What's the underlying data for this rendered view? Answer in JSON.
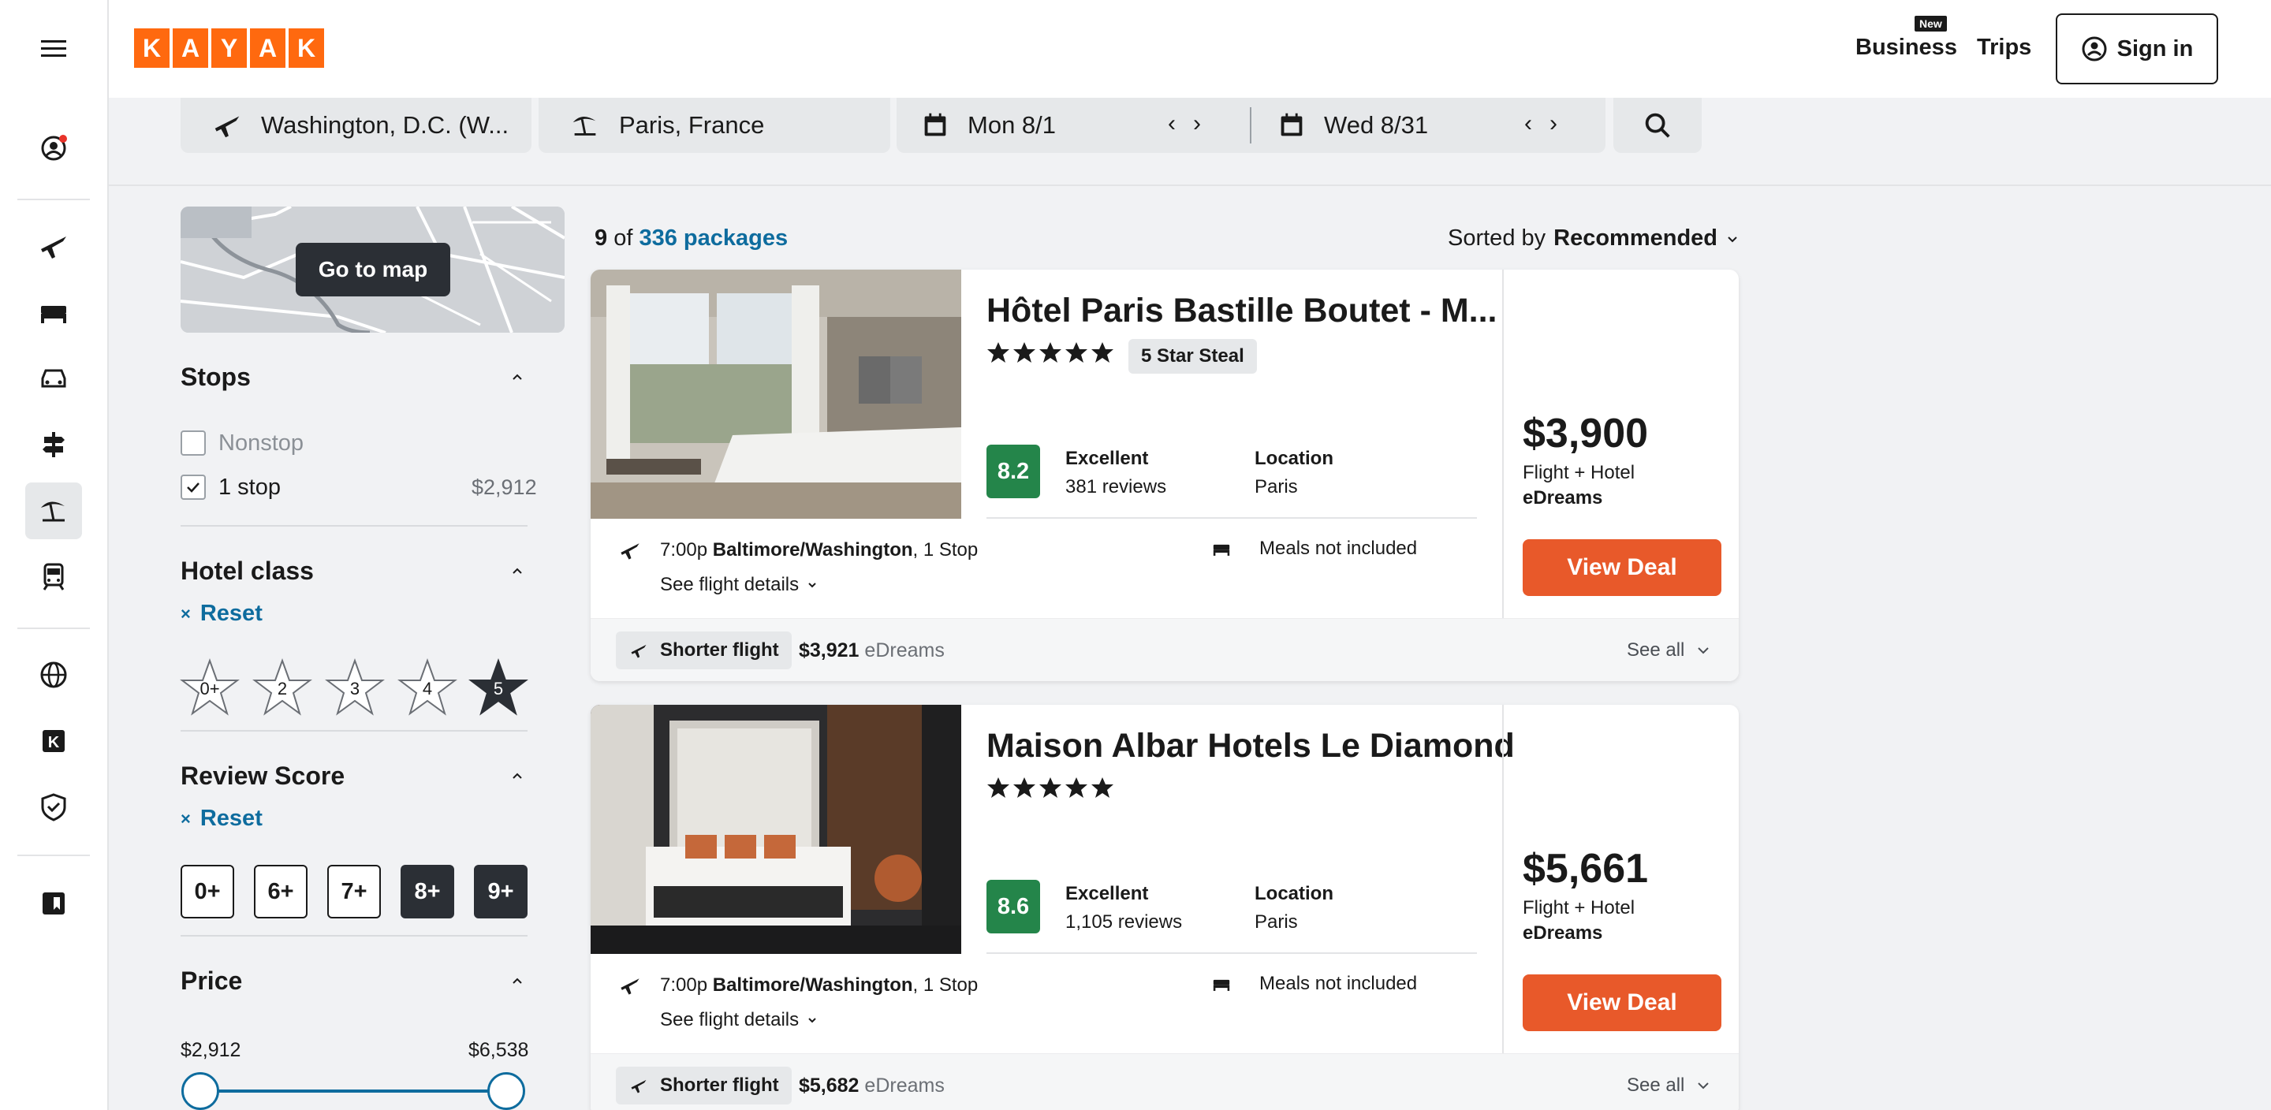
{
  "header": {
    "logo_letters": [
      "K",
      "A",
      "Y",
      "A",
      "K"
    ],
    "business_label": "Business",
    "new_badge": "New",
    "trips_label": "Trips",
    "signin_label": "Sign in"
  },
  "sidebar": {
    "icons": [
      "menu-icon",
      "profile-icon",
      "flights-icon",
      "stays-icon",
      "cars-icon",
      "explore-icon",
      "packages-icon",
      "trains-icon",
      "globe-icon",
      "kayak-icon",
      "shield-icon",
      "trips-book-icon"
    ],
    "active": "packages-icon"
  },
  "search": {
    "origin": "Washington, D.C. (W...",
    "destination": "Paris, France",
    "depart": "Mon 8/1",
    "return": "Wed 8/31"
  },
  "map": {
    "button_label": "Go to map"
  },
  "filters": {
    "stops": {
      "title": "Stops",
      "options": [
        {
          "label": "Nonstop",
          "price": "",
          "checked": false
        },
        {
          "label": "1 stop",
          "price": "$2,912",
          "checked": true
        }
      ]
    },
    "hotel_class": {
      "title": "Hotel class",
      "reset_label": "Reset",
      "stars": [
        "0+",
        "2",
        "3",
        "4",
        "5"
      ],
      "selected": "5"
    },
    "review_score": {
      "title": "Review Score",
      "reset_label": "Reset",
      "options": [
        "0+",
        "6+",
        "7+",
        "8+",
        "9+"
      ],
      "selected": [
        "8+",
        "9+"
      ]
    },
    "price": {
      "title": "Price",
      "min_label": "$2,912",
      "max_label": "$6,538",
      "range_selected": [
        0.0,
        1.0
      ]
    }
  },
  "results": {
    "count_shown": "9",
    "of_label": "of",
    "total_link": "336 packages",
    "sorted_by_label": "Sorted by",
    "sorted_value": "Recommended"
  },
  "cards": [
    {
      "name": "Hôtel Paris Bastille Boutet - M...",
      "stars": 5,
      "tag": "5 Star Steal",
      "score": "8.2",
      "rating_word": "Excellent",
      "reviews": "381 reviews",
      "location_label": "Location",
      "location": "Paris",
      "flight_time": "7:00p",
      "flight_airport": "Baltimore/Washington",
      "flight_stops": ", 1 Stop",
      "see_details": "See flight details",
      "meals": "Meals not included",
      "price": "$3,900",
      "price_type": "Flight + Hotel",
      "provider": "eDreams",
      "cta": "View Deal",
      "shorter_label": "Shorter flight",
      "alt_price": "$3,921",
      "alt_provider": "eDreams",
      "see_all": "See all"
    },
    {
      "name": "Maison Albar Hotels Le Diamond",
      "stars": 5,
      "tag": "",
      "score": "8.6",
      "rating_word": "Excellent",
      "reviews": "1,105 reviews",
      "location_label": "Location",
      "location": "Paris",
      "flight_time": "7:00p",
      "flight_airport": "Baltimore/Washington",
      "flight_stops": ", 1 Stop",
      "see_details": "See flight details",
      "meals": "Meals not included",
      "price": "$5,661",
      "price_type": "Flight + Hotel",
      "provider": "eDreams",
      "cta": "View Deal",
      "shorter_label": "Shorter flight",
      "alt_price": "$5,682",
      "alt_provider": "eDreams",
      "see_all": "See all"
    }
  ],
  "colors": {
    "brand": "#ff690f",
    "link": "#0e6c9e",
    "cta": "#e8592a",
    "score_green": "#24854a"
  }
}
